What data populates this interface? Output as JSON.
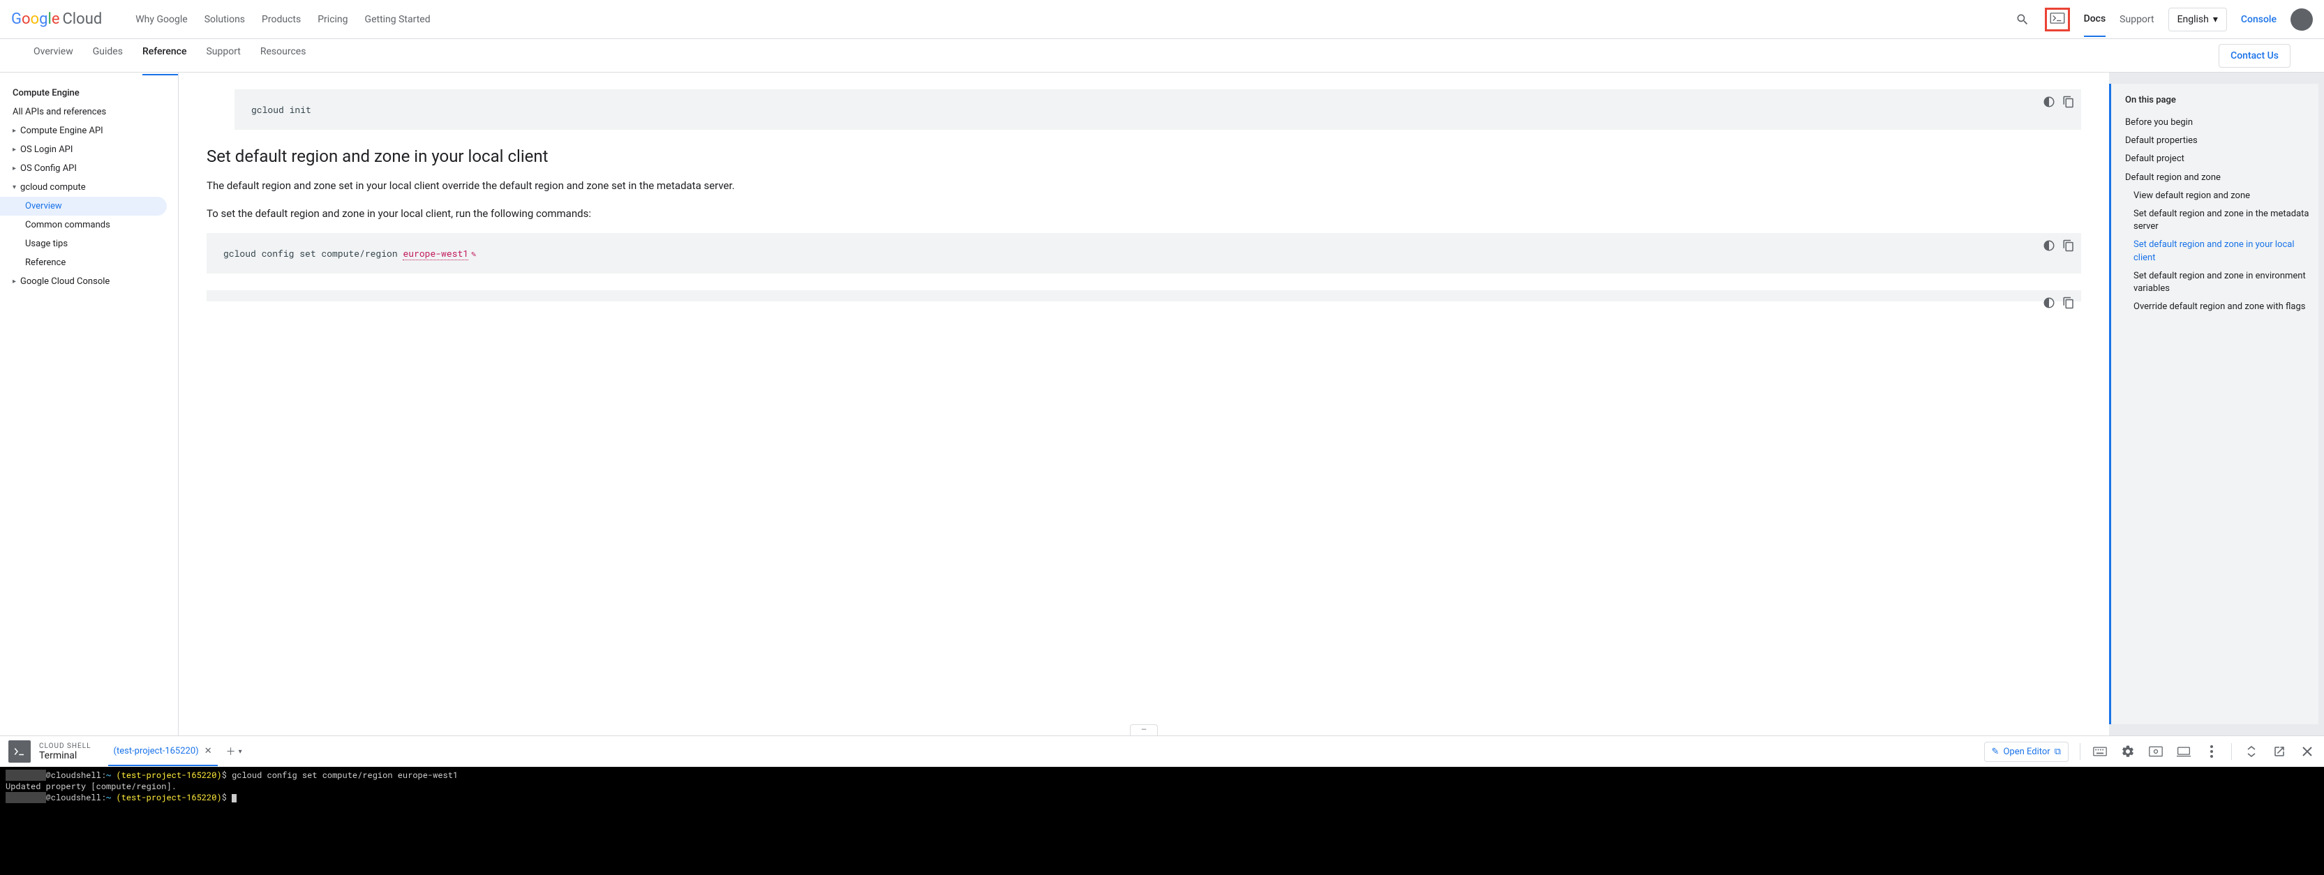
{
  "header": {
    "logo_cloud": "Cloud",
    "nav": [
      "Why Google",
      "Solutions",
      "Products",
      "Pricing",
      "Getting Started"
    ],
    "docs": "Docs",
    "support": "Support",
    "language": "English",
    "console": "Console"
  },
  "subheader": {
    "tabs": [
      "Overview",
      "Guides",
      "Reference",
      "Support",
      "Resources"
    ],
    "active_index": 2,
    "contact": "Contact Us"
  },
  "sidebar": {
    "items": [
      {
        "label": "Compute Engine",
        "bold": true
      },
      {
        "label": "All APIs and references"
      },
      {
        "label": "Compute Engine API",
        "arrow": true
      },
      {
        "label": "OS Login API",
        "arrow": true
      },
      {
        "label": "OS Config API",
        "arrow": true
      },
      {
        "label": "gcloud compute",
        "expanded": true
      },
      {
        "label": "Overview",
        "indent": true,
        "active": true
      },
      {
        "label": "Common commands",
        "indent": true
      },
      {
        "label": "Usage tips",
        "indent": true
      },
      {
        "label": "Reference",
        "indent": true
      },
      {
        "label": "Google Cloud Console",
        "arrow": true
      }
    ]
  },
  "content": {
    "code1": "gcloud init",
    "heading": "Set default region and zone in your local client",
    "para1": "The default region and zone set in your local client override the default region and zone set in the metadata server.",
    "para2": "To set the default region and zone in your local client, run the following commands:",
    "code2_prefix": "gcloud config set compute/region ",
    "code2_var": "europe-west1"
  },
  "toc": {
    "title": "On this page",
    "items": [
      {
        "label": "Before you begin"
      },
      {
        "label": "Default properties"
      },
      {
        "label": "Default project"
      },
      {
        "label": "Default region and zone"
      },
      {
        "label": "View default region and zone",
        "indent": true
      },
      {
        "label": "Set default region and zone in the metadata server",
        "indent": true
      },
      {
        "label": "Set default region and zone in your local client",
        "indent": true,
        "active": true
      },
      {
        "label": "Set default region and zone in environment variables",
        "indent": true
      },
      {
        "label": "Override default region and zone with flags",
        "indent": true
      }
    ]
  },
  "shell": {
    "brand_small": "CLOUD SHELL",
    "brand_title": "Terminal",
    "tab_name": "(test-project-165220)",
    "open_editor": "Open Editor",
    "lines": [
      {
        "prompt_host": "@cloudshell:",
        "tilde": "~ ",
        "project": "(test-project-165220)",
        "dollar": "$ ",
        "cmd": "gcloud config set compute/region europe-west1"
      },
      {
        "plain": "Updated property [compute/region]."
      },
      {
        "prompt_host": "@cloudshell:",
        "tilde": "~ ",
        "project": "(test-project-165220)",
        "dollar": "$ ",
        "cursor": true
      }
    ]
  }
}
